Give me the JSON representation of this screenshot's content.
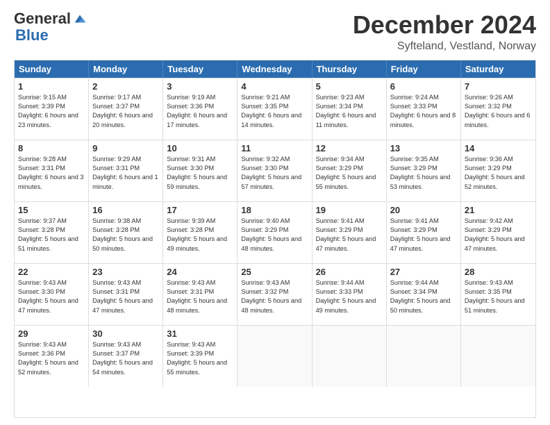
{
  "header": {
    "logo_general": "General",
    "logo_blue": "Blue",
    "month_title": "December 2024",
    "location": "Syfteland, Vestland, Norway"
  },
  "calendar": {
    "days_of_week": [
      "Sunday",
      "Monday",
      "Tuesday",
      "Wednesday",
      "Thursday",
      "Friday",
      "Saturday"
    ],
    "weeks": [
      [
        {
          "day": "",
          "empty": true
        },
        {
          "day": "",
          "empty": true
        },
        {
          "day": "",
          "empty": true
        },
        {
          "day": "",
          "empty": true
        },
        {
          "day": "",
          "empty": true
        },
        {
          "day": "",
          "empty": true
        },
        {
          "day": "",
          "empty": true
        }
      ],
      [
        {
          "day": "1",
          "sunrise": "Sunrise: 9:15 AM",
          "sunset": "Sunset: 3:39 PM",
          "daylight": "Daylight: 6 hours and 23 minutes."
        },
        {
          "day": "2",
          "sunrise": "Sunrise: 9:17 AM",
          "sunset": "Sunset: 3:37 PM",
          "daylight": "Daylight: 6 hours and 20 minutes."
        },
        {
          "day": "3",
          "sunrise": "Sunrise: 9:19 AM",
          "sunset": "Sunset: 3:36 PM",
          "daylight": "Daylight: 6 hours and 17 minutes."
        },
        {
          "day": "4",
          "sunrise": "Sunrise: 9:21 AM",
          "sunset": "Sunset: 3:35 PM",
          "daylight": "Daylight: 6 hours and 14 minutes."
        },
        {
          "day": "5",
          "sunrise": "Sunrise: 9:23 AM",
          "sunset": "Sunset: 3:34 PM",
          "daylight": "Daylight: 6 hours and 11 minutes."
        },
        {
          "day": "6",
          "sunrise": "Sunrise: 9:24 AM",
          "sunset": "Sunset: 3:33 PM",
          "daylight": "Daylight: 6 hours and 8 minutes."
        },
        {
          "day": "7",
          "sunrise": "Sunrise: 9:26 AM",
          "sunset": "Sunset: 3:32 PM",
          "daylight": "Daylight: 6 hours and 6 minutes."
        }
      ],
      [
        {
          "day": "8",
          "sunrise": "Sunrise: 9:28 AM",
          "sunset": "Sunset: 3:31 PM",
          "daylight": "Daylight: 6 hours and 3 minutes."
        },
        {
          "day": "9",
          "sunrise": "Sunrise: 9:29 AM",
          "sunset": "Sunset: 3:31 PM",
          "daylight": "Daylight: 6 hours and 1 minute."
        },
        {
          "day": "10",
          "sunrise": "Sunrise: 9:31 AM",
          "sunset": "Sunset: 3:30 PM",
          "daylight": "Daylight: 5 hours and 59 minutes."
        },
        {
          "day": "11",
          "sunrise": "Sunrise: 9:32 AM",
          "sunset": "Sunset: 3:30 PM",
          "daylight": "Daylight: 5 hours and 57 minutes."
        },
        {
          "day": "12",
          "sunrise": "Sunrise: 9:34 AM",
          "sunset": "Sunset: 3:29 PM",
          "daylight": "Daylight: 5 hours and 55 minutes."
        },
        {
          "day": "13",
          "sunrise": "Sunrise: 9:35 AM",
          "sunset": "Sunset: 3:29 PM",
          "daylight": "Daylight: 5 hours and 53 minutes."
        },
        {
          "day": "14",
          "sunrise": "Sunrise: 9:36 AM",
          "sunset": "Sunset: 3:29 PM",
          "daylight": "Daylight: 5 hours and 52 minutes."
        }
      ],
      [
        {
          "day": "15",
          "sunrise": "Sunrise: 9:37 AM",
          "sunset": "Sunset: 3:28 PM",
          "daylight": "Daylight: 5 hours and 51 minutes."
        },
        {
          "day": "16",
          "sunrise": "Sunrise: 9:38 AM",
          "sunset": "Sunset: 3:28 PM",
          "daylight": "Daylight: 5 hours and 50 minutes."
        },
        {
          "day": "17",
          "sunrise": "Sunrise: 9:39 AM",
          "sunset": "Sunset: 3:28 PM",
          "daylight": "Daylight: 5 hours and 49 minutes."
        },
        {
          "day": "18",
          "sunrise": "Sunrise: 9:40 AM",
          "sunset": "Sunset: 3:29 PM",
          "daylight": "Daylight: 5 hours and 48 minutes."
        },
        {
          "day": "19",
          "sunrise": "Sunrise: 9:41 AM",
          "sunset": "Sunset: 3:29 PM",
          "daylight": "Daylight: 5 hours and 47 minutes."
        },
        {
          "day": "20",
          "sunrise": "Sunrise: 9:41 AM",
          "sunset": "Sunset: 3:29 PM",
          "daylight": "Daylight: 5 hours and 47 minutes."
        },
        {
          "day": "21",
          "sunrise": "Sunrise: 9:42 AM",
          "sunset": "Sunset: 3:29 PM",
          "daylight": "Daylight: 5 hours and 47 minutes."
        }
      ],
      [
        {
          "day": "22",
          "sunrise": "Sunrise: 9:43 AM",
          "sunset": "Sunset: 3:30 PM",
          "daylight": "Daylight: 5 hours and 47 minutes."
        },
        {
          "day": "23",
          "sunrise": "Sunrise: 9:43 AM",
          "sunset": "Sunset: 3:31 PM",
          "daylight": "Daylight: 5 hours and 47 minutes."
        },
        {
          "day": "24",
          "sunrise": "Sunrise: 9:43 AM",
          "sunset": "Sunset: 3:31 PM",
          "daylight": "Daylight: 5 hours and 48 minutes."
        },
        {
          "day": "25",
          "sunrise": "Sunrise: 9:43 AM",
          "sunset": "Sunset: 3:32 PM",
          "daylight": "Daylight: 5 hours and 48 minutes."
        },
        {
          "day": "26",
          "sunrise": "Sunrise: 9:44 AM",
          "sunset": "Sunset: 3:33 PM",
          "daylight": "Daylight: 5 hours and 49 minutes."
        },
        {
          "day": "27",
          "sunrise": "Sunrise: 9:44 AM",
          "sunset": "Sunset: 3:34 PM",
          "daylight": "Daylight: 5 hours and 50 minutes."
        },
        {
          "day": "28",
          "sunrise": "Sunrise: 9:43 AM",
          "sunset": "Sunset: 3:35 PM",
          "daylight": "Daylight: 5 hours and 51 minutes."
        }
      ],
      [
        {
          "day": "29",
          "sunrise": "Sunrise: 9:43 AM",
          "sunset": "Sunset: 3:36 PM",
          "daylight": "Daylight: 5 hours and 52 minutes."
        },
        {
          "day": "30",
          "sunrise": "Sunrise: 9:43 AM",
          "sunset": "Sunset: 3:37 PM",
          "daylight": "Daylight: 5 hours and 54 minutes."
        },
        {
          "day": "31",
          "sunrise": "Sunrise: 9:43 AM",
          "sunset": "Sunset: 3:39 PM",
          "daylight": "Daylight: 5 hours and 55 minutes."
        },
        {
          "day": "",
          "empty": true
        },
        {
          "day": "",
          "empty": true
        },
        {
          "day": "",
          "empty": true
        },
        {
          "day": "",
          "empty": true
        }
      ]
    ]
  }
}
